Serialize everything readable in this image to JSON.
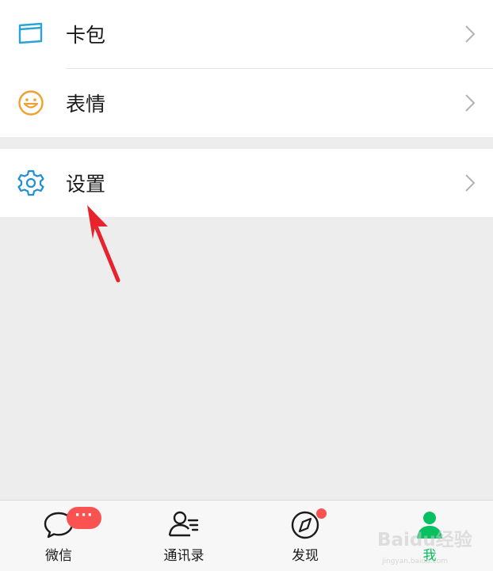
{
  "menu": {
    "card_pack": {
      "label": "卡包",
      "icon": "card-icon"
    },
    "stickers": {
      "label": "表情",
      "icon": "smiley-icon"
    },
    "settings": {
      "label": "设置",
      "icon": "gear-icon"
    }
  },
  "tabbar": {
    "tabs": [
      {
        "label": "微信",
        "icon": "chat-bubble-icon",
        "badge": "···"
      },
      {
        "label": "通讯录",
        "icon": "contacts-icon"
      },
      {
        "label": "发现",
        "icon": "compass-icon",
        "dot": true
      },
      {
        "label": "我",
        "icon": "person-icon",
        "active": true
      }
    ]
  },
  "watermark": {
    "text": "Baidu经验",
    "sub": "jingyan.baidu.com"
  },
  "colors": {
    "accent": "#07c160",
    "badge": "#fa5151",
    "icon_blue": "#1f8fd8",
    "icon_orange": "#f0a030"
  }
}
